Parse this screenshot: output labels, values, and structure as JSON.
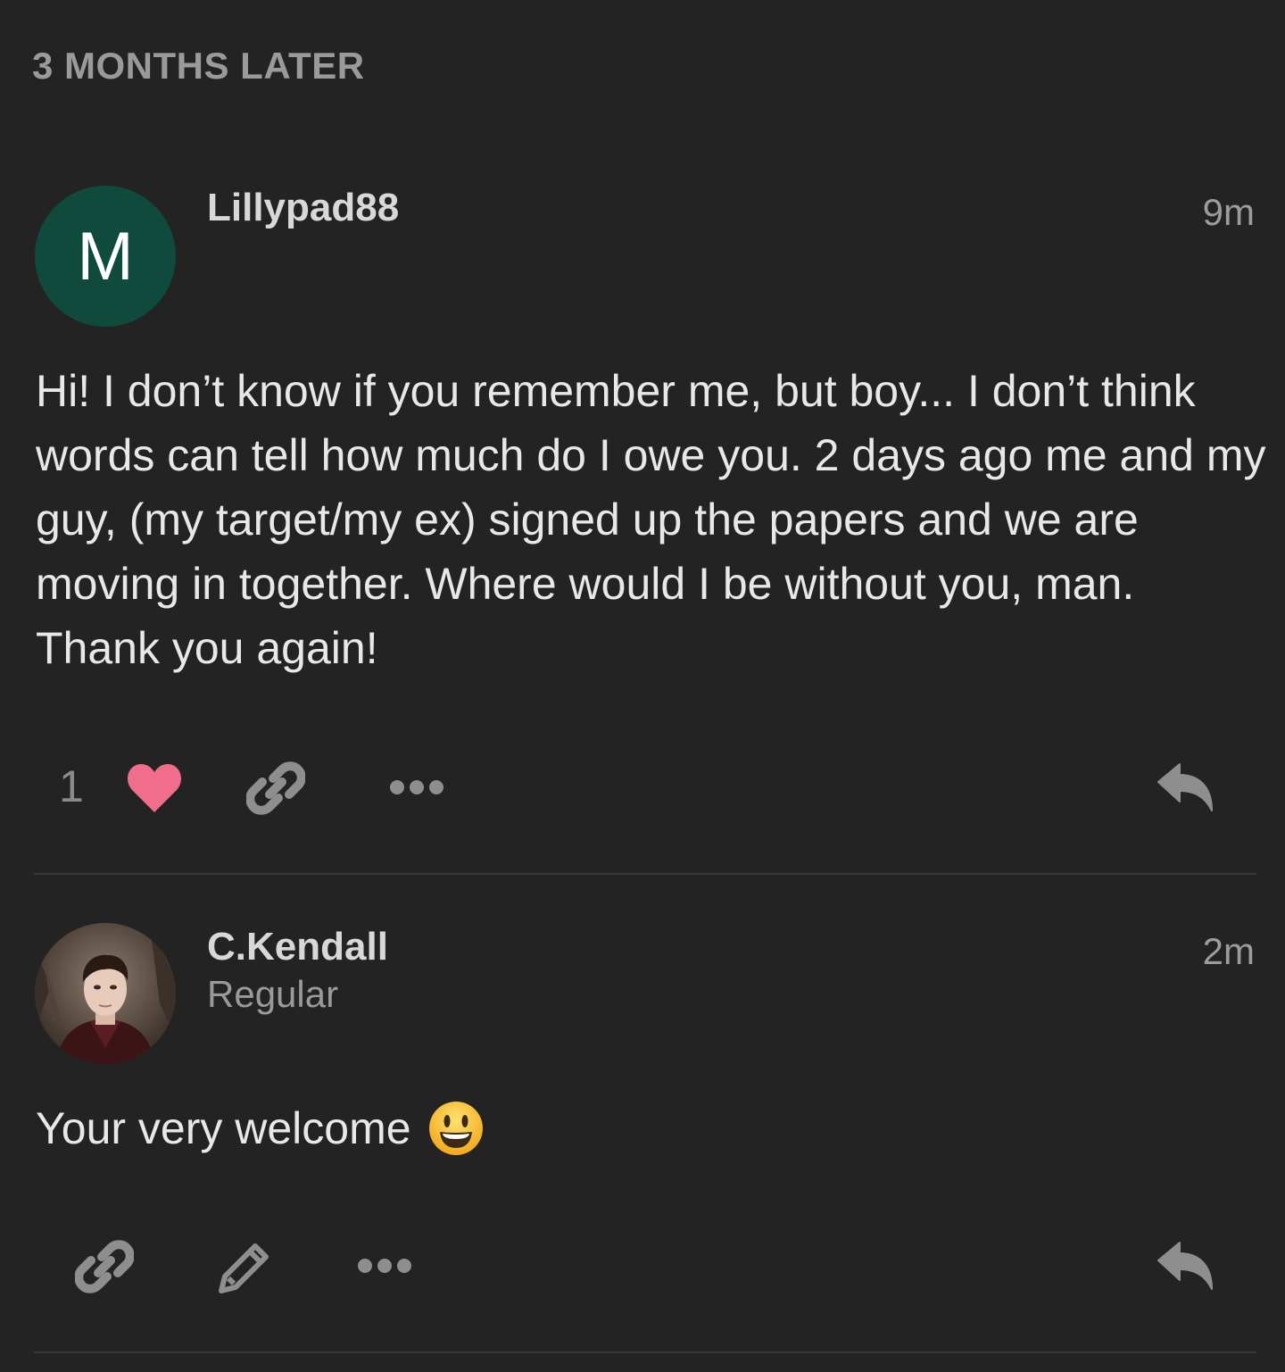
{
  "topic": {
    "time_gap_label": "3 MONTHS LATER"
  },
  "posts": [
    {
      "avatar": {
        "letter": "M",
        "color": "#0f4a3c"
      },
      "username": "Lillypad88",
      "age": "9m",
      "body": "Hi! I don’t know if you remember me, but boy... I don’t think words can tell how much do I owe you. 2 days ago me and my guy, (my target/my ex) signed up the papers and we are moving in together. Where would I be without you, man. Thank you again!",
      "like_count": "1",
      "actions": [
        "heart-icon",
        "link-icon",
        "more-icon",
        "reply-icon"
      ],
      "like_color": "#f06d8c"
    },
    {
      "avatar": {
        "type": "photo"
      },
      "username": "C.Kendall",
      "user_title": "Regular",
      "age": "2m",
      "body": "Your very welcome",
      "emoji": "smiley-emoji",
      "actions": [
        "link-icon",
        "pencil-icon",
        "more-icon",
        "reply-icon"
      ]
    }
  ],
  "colors": {
    "background": "#232323",
    "text": "#e8e8e8",
    "muted": "#9a9a9a",
    "icon": "#8e8e8e",
    "divider": "#383838"
  }
}
